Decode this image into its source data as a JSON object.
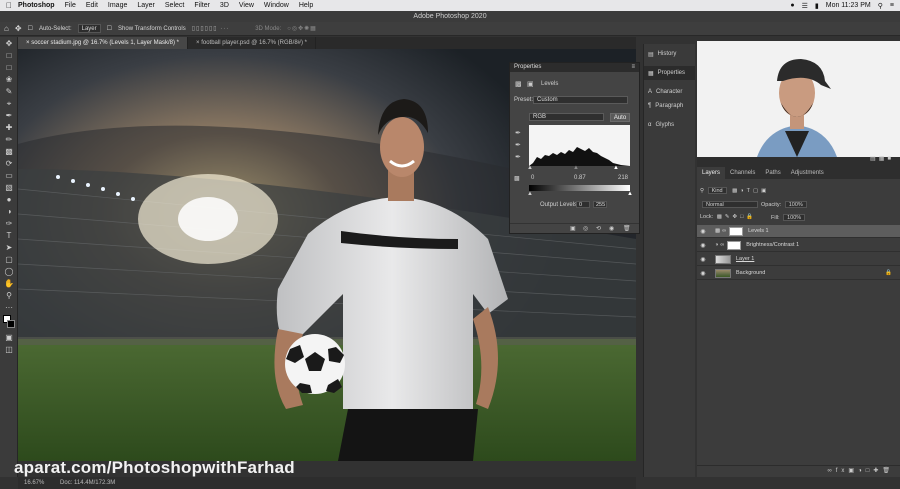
{
  "menubar": {
    "app": "Photoshop",
    "items": [
      "File",
      "Edit",
      "Image",
      "Layer",
      "Select",
      "Filter",
      "3D",
      "View",
      "Window",
      "Help"
    ],
    "clock": "Mon 11:23 PM"
  },
  "app_title": "Adobe Photoshop 2020",
  "options": {
    "auto_select_label": "Auto-Select:",
    "auto_select_value": "Layer",
    "transform_label": "Show Transform Controls",
    "mode_label": "3D Mode:"
  },
  "tabs": [
    {
      "label": "soccer stadium.jpg @ 16.7% (Levels 1, Layer Mask/8) *"
    },
    {
      "label": "football player.psd @ 16.7% (RGB/8#) *"
    }
  ],
  "properties": {
    "title": "Properties",
    "adjustment": "Levels",
    "preset_label": "Preset:",
    "preset_value": "Custom",
    "channel": "RGB",
    "auto_label": "Auto",
    "input_black": "0",
    "input_gamma": "0.87",
    "input_white": "218",
    "output_label": "Output Levels:",
    "output_black": "0",
    "output_white": "255"
  },
  "mid_panel": {
    "items": [
      {
        "label": "History",
        "icon": "history-icon"
      },
      {
        "label": "Properties",
        "icon": "properties-icon"
      },
      {
        "label": "Character",
        "icon": "character-icon"
      },
      {
        "label": "Paragraph",
        "icon": "paragraph-icon"
      },
      {
        "label": "Glyphs",
        "icon": "glyphs-icon"
      }
    ]
  },
  "layers_panel": {
    "tabs": [
      "Layers",
      "Channels",
      "Paths",
      "Adjustments"
    ],
    "filter_value": "Kind",
    "blend_mode": "Normal",
    "opacity_label": "Opacity:",
    "opacity_value": "100%",
    "lock_label": "Lock:",
    "fill_label": "Fill:",
    "fill_value": "100%",
    "layers": [
      {
        "name": "Levels 1",
        "selected": true
      },
      {
        "name": "Brightness/Contrast 1",
        "selected": false
      },
      {
        "name": "Layer 1",
        "selected": false
      },
      {
        "name": "Background",
        "selected": false
      }
    ]
  },
  "status": {
    "zoom": "16.67%",
    "doc": "Doc: 114.4M/172.3M"
  },
  "watermark": "aparat.com/PhotoshopwithFarhad"
}
